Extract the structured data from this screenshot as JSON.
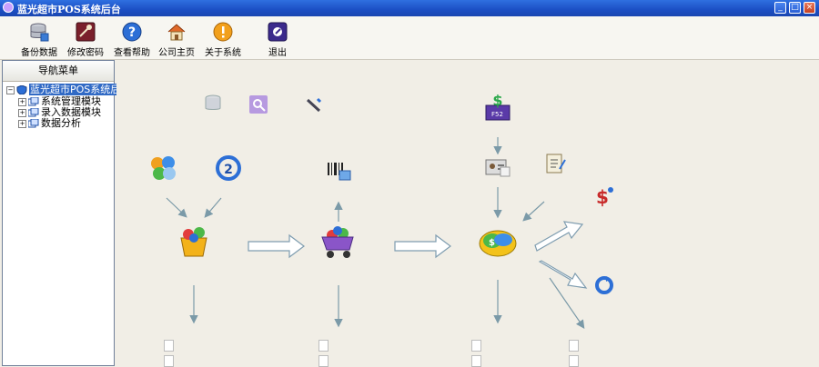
{
  "window": {
    "title": "蓝光超市POS系统后台",
    "min": "_",
    "max": "□",
    "close": "×"
  },
  "toolbar": {
    "items": [
      "备份数据",
      "修改密码",
      "查看帮助",
      "公司主页",
      "关于系统",
      "退出"
    ]
  },
  "nav": {
    "header": "导航菜单",
    "root": "蓝光超市POS系统后",
    "items": [
      "系统管理模块",
      "录入数据模块",
      "数据分析"
    ]
  },
  "desk": {
    "modules": [
      "",
      "",
      "",
      "",
      "",
      "",
      "",
      "",
      "",
      "",
      "",
      "",
      "",
      ""
    ],
    "docs": [
      "",
      "",
      "",
      "",
      "",
      "",
      "",
      ""
    ]
  }
}
